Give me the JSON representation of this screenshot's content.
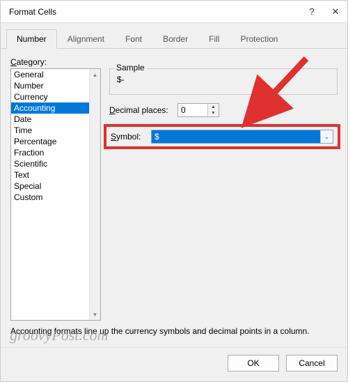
{
  "window": {
    "title": "Format Cells",
    "help": "?",
    "close": "✕"
  },
  "tabs": [
    {
      "label": "Number",
      "active": true
    },
    {
      "label": "Alignment",
      "active": false
    },
    {
      "label": "Font",
      "active": false
    },
    {
      "label": "Border",
      "active": false
    },
    {
      "label": "Fill",
      "active": false
    },
    {
      "label": "Protection",
      "active": false
    }
  ],
  "category": {
    "label": "Category:",
    "items": [
      "General",
      "Number",
      "Currency",
      "Accounting",
      "Date",
      "Time",
      "Percentage",
      "Fraction",
      "Scientific",
      "Text",
      "Special",
      "Custom"
    ],
    "selected": "Accounting"
  },
  "sample": {
    "label": "Sample",
    "value": "$-"
  },
  "decimal": {
    "label": "Decimal places:",
    "value": "0"
  },
  "symbol": {
    "label": "Symbol:",
    "value": "$"
  },
  "description": "Accounting formats line up the currency symbols and decimal points in a column.",
  "buttons": {
    "ok": "OK",
    "cancel": "Cancel"
  },
  "watermark": "groovyPost.com",
  "colors": {
    "highlight": "#e03030",
    "selection": "#0078d7"
  }
}
